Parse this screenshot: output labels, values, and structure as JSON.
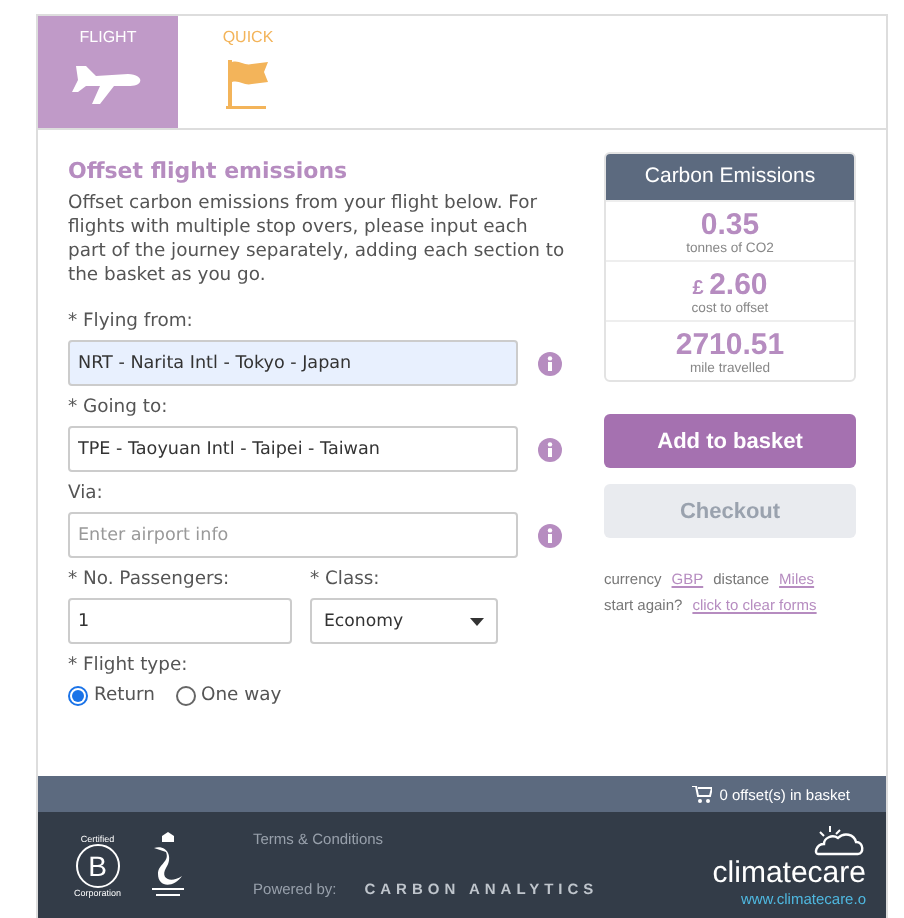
{
  "tabs": [
    {
      "label": "FLIGHT",
      "kind": "plane",
      "selected": true
    },
    {
      "label": "QUICK",
      "kind": "flag",
      "selected": false
    }
  ],
  "form": {
    "title": "Offset flight emissions",
    "intro": "Offset carbon emissions from your flight below. For flights with multiple stop overs, please input each part of the journey separately, adding each section to the basket as you go.",
    "fields": [
      {
        "label": "* Flying from:",
        "value": "NRT - Narita Intl - Tokyo - Japan",
        "focused": true
      },
      {
        "label": "* Going to:",
        "value": "TPE - Taoyuan Intl - Taipei - Taiwan",
        "focused": false
      },
      {
        "label": "Via:",
        "placeholder": "Enter airport info",
        "focused": false
      }
    ],
    "passengers": {
      "label": "* No. Passengers:",
      "value": "1"
    },
    "class": {
      "label": "* Class:",
      "value": "Economy"
    },
    "flight_type": {
      "label": "* Flight type:",
      "options": [
        {
          "label": "Return",
          "selected": true
        },
        {
          "label": "One way",
          "selected": false
        }
      ]
    }
  },
  "emissions": {
    "title": "Carbon Emissions",
    "stats": [
      {
        "value": "0.35",
        "caption": "tonnes of CO2"
      },
      {
        "prefix": "£",
        "value": "2.60",
        "caption": "cost to offset"
      },
      {
        "value": "2710.51",
        "caption": "mile travelled"
      }
    ]
  },
  "buttons": [
    {
      "label": "Add to basket",
      "disabled": false
    },
    {
      "label": "Checkout",
      "disabled": true
    }
  ],
  "settings": [
    {
      "label": "currency",
      "link": "GBP"
    },
    {
      "label": "distance",
      "link": "Miles"
    }
  ],
  "clear": {
    "label": "start again?",
    "link": "click to clear forms"
  },
  "basket": "0 offset(s) in basket",
  "footer": {
    "bcorp_top": "Certified",
    "bcorp_letter": "B",
    "bcorp_bottom": "Corporation",
    "terms": "Terms & Conditions",
    "powered": "Powered by:",
    "partner": "CARBON ANALYTICS",
    "brand": "climatecare",
    "url": "www.climatecare.o"
  }
}
